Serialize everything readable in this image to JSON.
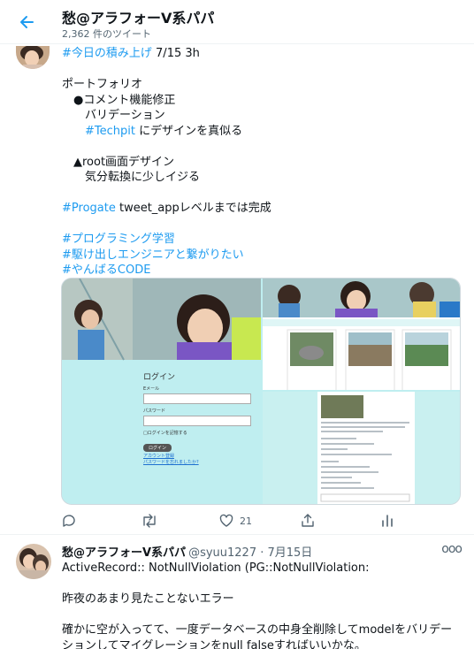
{
  "header": {
    "title": "愁@アラフォーV系パパ",
    "subtitle": "2,362 件のツイート"
  },
  "tweet1": {
    "line1_tag": "#今日の積み上げ",
    "line1_rest": " 7/15 3h",
    "line2": "ポートフォリオ",
    "line3": "　●コメント機能修正",
    "line4": "　　バリデーション",
    "line5_tag": "　　#Techpit",
    "line5_rest": " にデザインを真似る",
    "line6": "　▲root画面デザイン",
    "line7": "　　気分転換に少しイジる",
    "line8_tag": "#Progate",
    "line8_rest": " tweet_appレベルまでは完成",
    "tag1": "#プログラミング学習",
    "tag2": "#駆け出しエンジニアと繋がりたい",
    "tag3": "#やんばるCODE",
    "media": {
      "login_title": "ログイン",
      "email_label": "Eメール",
      "password_label": "パスワード",
      "remember_label": "□ログインを記憶する",
      "login_button": "ログイン",
      "signup_link": "アカウント登録",
      "forgot_link": "パスワードを忘れましたか?"
    },
    "actions": {
      "likes": "21"
    }
  },
  "tweet2": {
    "name": "愁@アラフォーV系パパ",
    "handle": "@syuu1227 · 7月15日",
    "more": "ooo",
    "line1": "ActiveRecord:: NotNullViolation (PG::NotNullViolation:",
    "line2": "昨夜のあまり見たことないエラー",
    "line3": "確かに空が入ってて、一度データベースの中身全削除してmodelをバリデー",
    "line4": "ションしてマイグレーションをnull falseすればいいかな。"
  },
  "colors": {
    "accent": "#1d9bf0",
    "secondary_text": "#536471",
    "media_background": "#bfeef0"
  }
}
